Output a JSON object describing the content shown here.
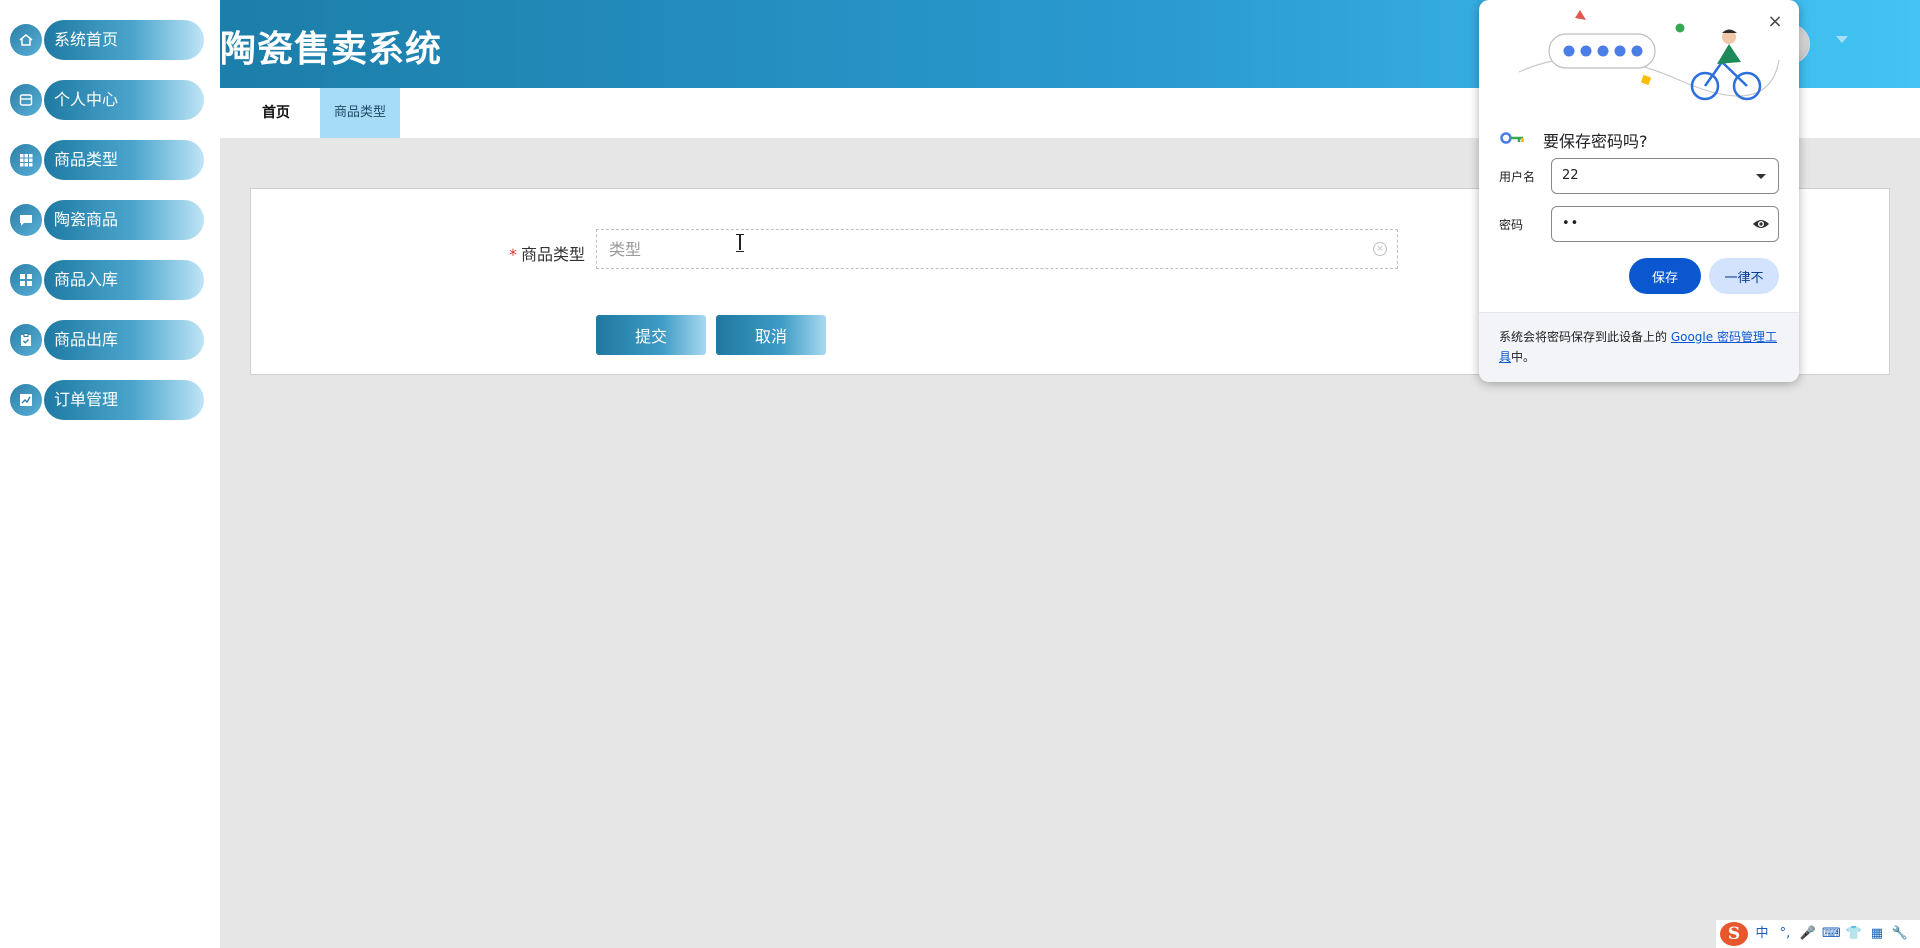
{
  "app": {
    "title": "陶瓷售卖系统"
  },
  "sidebar": {
    "items": [
      {
        "label": "系统首页",
        "icon": "home-icon"
      },
      {
        "label": "个人中心",
        "icon": "card-icon"
      },
      {
        "label": "商品类型",
        "icon": "grid-icon"
      },
      {
        "label": "陶瓷商品",
        "icon": "chat-icon"
      },
      {
        "label": "商品入库",
        "icon": "apps-icon"
      },
      {
        "label": "商品出库",
        "icon": "clipboard-icon"
      },
      {
        "label": "订单管理",
        "icon": "chart-icon"
      }
    ]
  },
  "tabs": {
    "home": "首页",
    "active": "商品类型"
  },
  "form": {
    "field_label": "商品类型",
    "required_mark": "*",
    "input_value": "",
    "input_placeholder": "类型",
    "submit_label": "提交",
    "cancel_label": "取消"
  },
  "password_popup": {
    "heading": "要保存密码吗?",
    "username_label": "用户名",
    "username_value": "22",
    "password_label": "密码",
    "password_value": "••",
    "save_label": "保存",
    "never_label": "一律不",
    "footer_text": "系统会将密码保存到此设备上的 ",
    "footer_link": "Google 密码管理工具",
    "footer_suffix": "中。",
    "close_glyph": "×"
  },
  "ime": {
    "logo": "S",
    "mode": "中",
    "punct": "°,",
    "mic": "🎤",
    "keyboard": "⌨",
    "shirt": "👕",
    "grid": "▦",
    "tool": "🔧"
  },
  "colors": {
    "accent": "#1f7aa3",
    "header_start": "#1c7ea9",
    "header_end": "#43c4f5",
    "active_tab_bg": "#a6dcf6",
    "required": "#e03434",
    "google_blue": "#0b57d0"
  }
}
